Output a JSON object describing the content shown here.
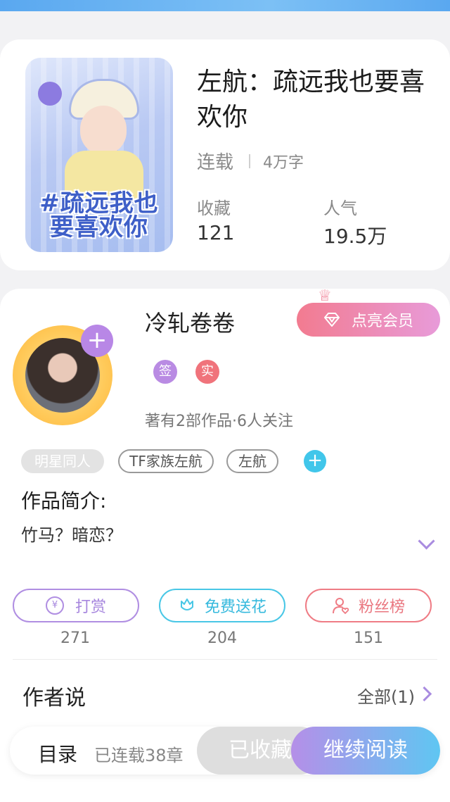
{
  "book": {
    "title": "左航：疏远我也要喜欢你",
    "status": "连载",
    "word_count": "4万字",
    "cover_text": "#疏远我也要喜欢你",
    "stats": [
      {
        "label": "收藏",
        "value": "121"
      },
      {
        "label": "人气",
        "value": "19.5万"
      }
    ]
  },
  "author": {
    "name": "冷轧卷卷",
    "vip_button": "点亮会员",
    "badges": [
      {
        "text": "签",
        "color": "#b98be3"
      },
      {
        "text": "实",
        "color": "#f0737b"
      }
    ],
    "works_info": "著有2部作品·6人关注"
  },
  "tags": [
    "明星同人",
    "TF家族左航",
    "左航"
  ],
  "intro": {
    "label": "作品简介:",
    "text": "竹马？暗恋？"
  },
  "actions": [
    {
      "label": "打赏",
      "count": "271",
      "icon": "yen-icon",
      "color": "#b08ee2"
    },
    {
      "label": "免费送花",
      "count": "204",
      "icon": "flower-icon",
      "color": "#49c7e6"
    },
    {
      "label": "粉丝榜",
      "count": "151",
      "icon": "user-heart-icon",
      "color": "#ef7c85"
    }
  ],
  "author_says": {
    "label": "作者说",
    "all": "全部(1)"
  },
  "bottom": {
    "catalog": "目录",
    "chapters": "已连载38章",
    "favorited": "已收藏",
    "continue": "继续阅读"
  }
}
